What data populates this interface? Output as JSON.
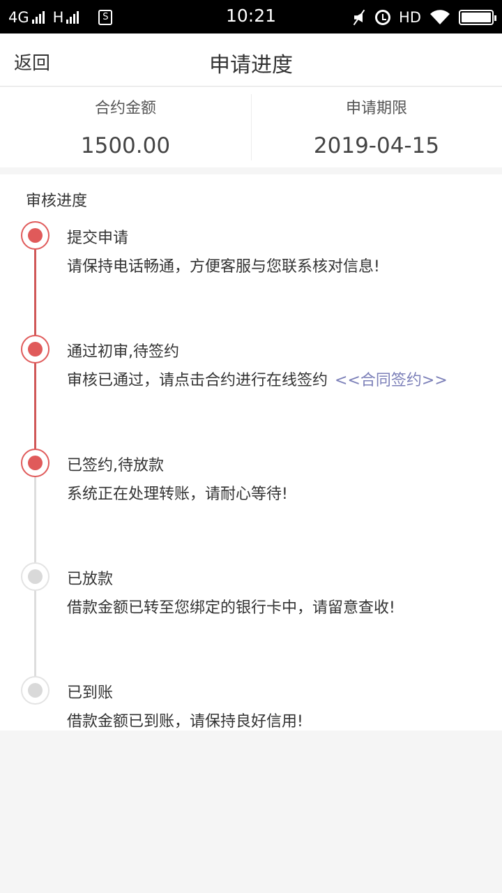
{
  "status_bar": {
    "network_1": "4G",
    "network_2": "H",
    "sim_badge": "S",
    "time": "10:21",
    "hd": "HD"
  },
  "header": {
    "back_label": "返回",
    "title": "申请进度"
  },
  "summary": {
    "amount_label": "合约金额",
    "amount_value": "1500.00",
    "term_label": "申请期限",
    "term_value": "2019-04-15"
  },
  "progress": {
    "section_title": "审核进度",
    "steps": [
      {
        "title": "提交申请",
        "desc": "请保持电话畅通，方便客服与您联系核对信息!",
        "done": true
      },
      {
        "title": "通过初审,待签约",
        "desc": "审核已通过，请点击合约进行在线签约",
        "link": "<<合同签约>>",
        "done": true
      },
      {
        "title": "已签约,待放款",
        "desc": "系统正在处理转账，请耐心等待!",
        "done": true
      },
      {
        "title": "已放款",
        "desc": "借款金额已转至您绑定的银行卡中，请留意查收!",
        "done": false
      },
      {
        "title": "已到账",
        "desc": "借款金额已到账，请保持良好信用!",
        "done": false
      }
    ]
  },
  "colors": {
    "active": "#e05a5a",
    "inactive_ring": "#e3e3e3",
    "inactive_dot": "#d9d9d9",
    "active_line": "#d05858",
    "inactive_line": "#dddddd",
    "link": "#7b7fb8"
  }
}
